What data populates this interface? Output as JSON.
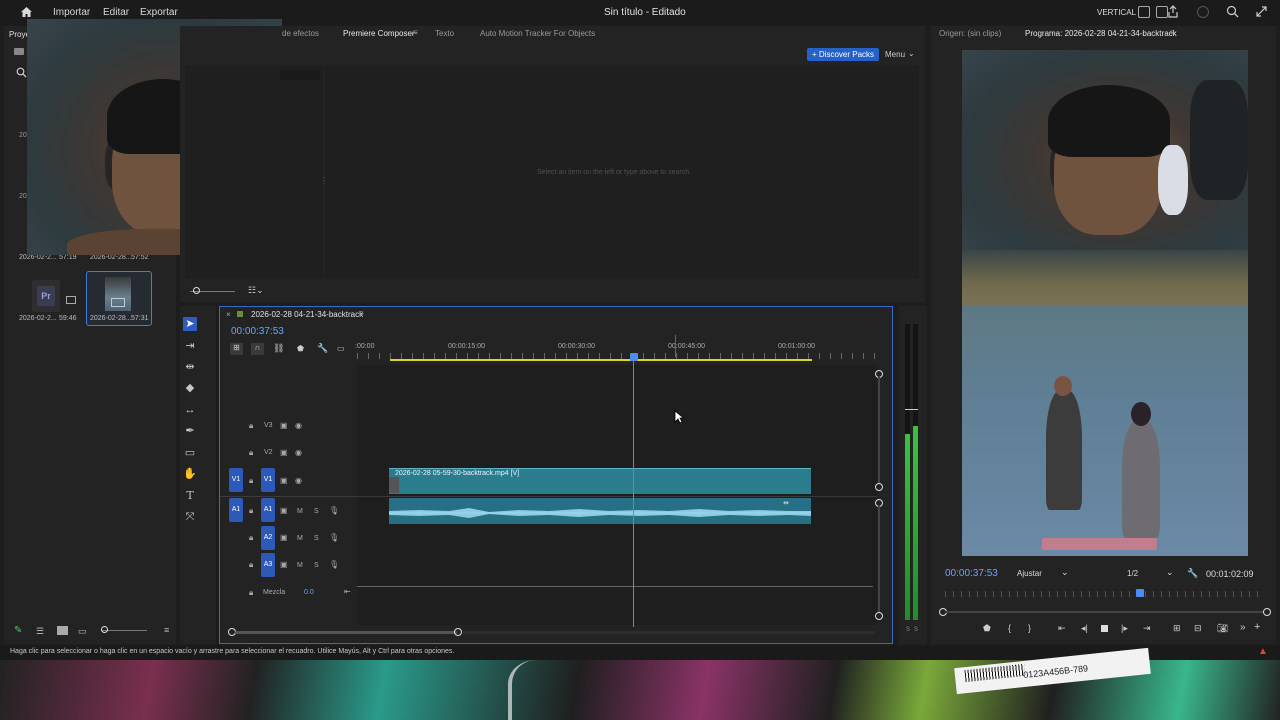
{
  "topbar": {
    "menu": [
      "Importar",
      "Editar",
      "Exportar"
    ],
    "title": "Sin título - Editado",
    "layout": "VERTICAL"
  },
  "project": {
    "tab": "Proye",
    "items": [
      {
        "name": "2026-02-2...",
        "duration": "57:19"
      },
      {
        "name": "2026-02-28...",
        "duration": "57:52"
      },
      {
        "name": "2026-02-2...",
        "duration": "59:46"
      },
      {
        "name": "2026-02-28...",
        "duration": "57:31"
      }
    ],
    "side_numbers": [
      "20",
      "20"
    ]
  },
  "effects": {
    "tabs": [
      "de efectos",
      "Premiere Composer",
      "Texto",
      "Auto Motion Tracker For Objects"
    ],
    "discover": "+ Discover Packs",
    "menu": "Menu",
    "empty_msg": "Select an item on the left or type above to search."
  },
  "timeline": {
    "sequence": "2026-02-28 04-21-34-backtrack",
    "timecode": "00:00:37:53",
    "ruler": [
      ":00:00",
      "00:00:15:00",
      "00:00:30:00",
      "00:00:45:00",
      "00:01:00:00"
    ],
    "tracks_video": [
      "V3",
      "V2",
      "V1"
    ],
    "tracks_audio": [
      "A1",
      "A2",
      "A3"
    ],
    "src_v": "V1",
    "src_a": "A1",
    "mix_label": "Mezcla",
    "mix_value": "0.0",
    "clip_name": "2026-02-28 05-59-30-backtrack.mp4 [V]",
    "m": "M",
    "s": "S"
  },
  "meter": {
    "labels": [
      "S",
      "S"
    ]
  },
  "program": {
    "tab_source": "Origen: (sin clips)",
    "tab_program": "Programa: 2026-02-28 04-21-34-backtrack",
    "timecode": "00:00:37:53",
    "fit": "Ajustar",
    "resolution": "1/2",
    "duration": "00:01:02:09",
    "playhead_fraction": 0.61
  },
  "status": {
    "text": "Haga clic para seleccionar o haga clic en un espacio vacío y arrastre para seleccionar el recuadro. Utilice Mayús, Alt y Ctrl para otras opciones."
  },
  "desktop": {
    "sticker_text": "0123A456B-789"
  }
}
